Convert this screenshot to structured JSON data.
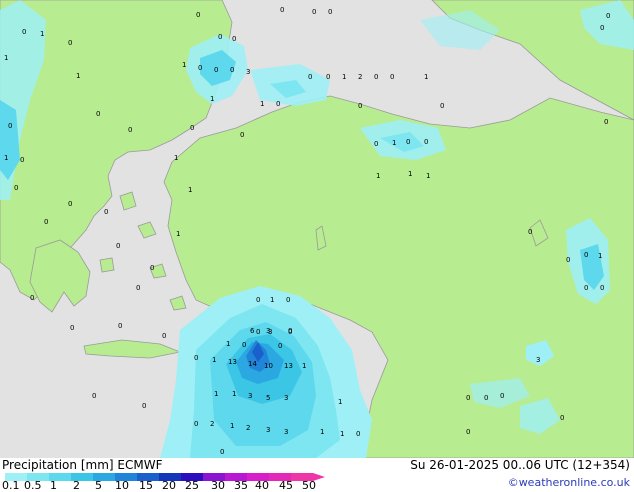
{
  "legend": {
    "title": "Precipitation [mm]",
    "model": "ECMWF",
    "levels": [
      "0.1",
      "0.5",
      "1",
      "2",
      "5",
      "10",
      "15",
      "20",
      "25",
      "30",
      "35",
      "40",
      "45",
      "50"
    ],
    "colors": [
      "#9ef0f6",
      "#7ee6f0",
      "#5ed8ec",
      "#3cc6e6",
      "#2ba8e2",
      "#2084d8",
      "#1a5fcc",
      "#1436b8",
      "#2a0ec0",
      "#8a14d0",
      "#b818d4",
      "#d81ec8",
      "#e428b8",
      "#ee36a8"
    ]
  },
  "datetime": "Su 26-01-2025 00..06 UTC (12+354)",
  "credit": "©weatheronline.co.uk",
  "map": {
    "land_color": "#b8ec90",
    "sea_color": "#e2e2e2",
    "values": [
      "0",
      "0",
      "1",
      "0",
      "0",
      "0",
      "3",
      "1",
      "1",
      "0",
      "0",
      "0",
      "1",
      "2",
      "0",
      "0",
      "1",
      "0",
      "0",
      "0",
      "0",
      "1",
      "0",
      "0",
      "1",
      "0",
      "0",
      "0",
      "0",
      "0",
      "0",
      "0",
      "0",
      "0",
      "0",
      "0",
      "1",
      "0",
      "0",
      "0",
      "0",
      "0",
      "1",
      "1",
      "1",
      "1",
      "3",
      "0",
      "0",
      "0",
      "1",
      "0",
      "0",
      "1",
      "0",
      "1",
      "0",
      "0",
      "1",
      "1",
      "0",
      "0",
      "3",
      "0",
      "0",
      "6",
      "3",
      "0",
      "13",
      "14",
      "10",
      "13",
      "1",
      "1",
      "1",
      "3",
      "5",
      "3",
      "1",
      "0",
      "2",
      "1",
      "2",
      "3",
      "3",
      "1",
      "1",
      "0",
      "0",
      "0",
      "0",
      "0",
      "0",
      "0",
      "1",
      "1",
      "0",
      "0",
      "0",
      "0",
      "0",
      "0",
      "0",
      "0",
      "0",
      "1",
      "0",
      "0"
    ]
  }
}
